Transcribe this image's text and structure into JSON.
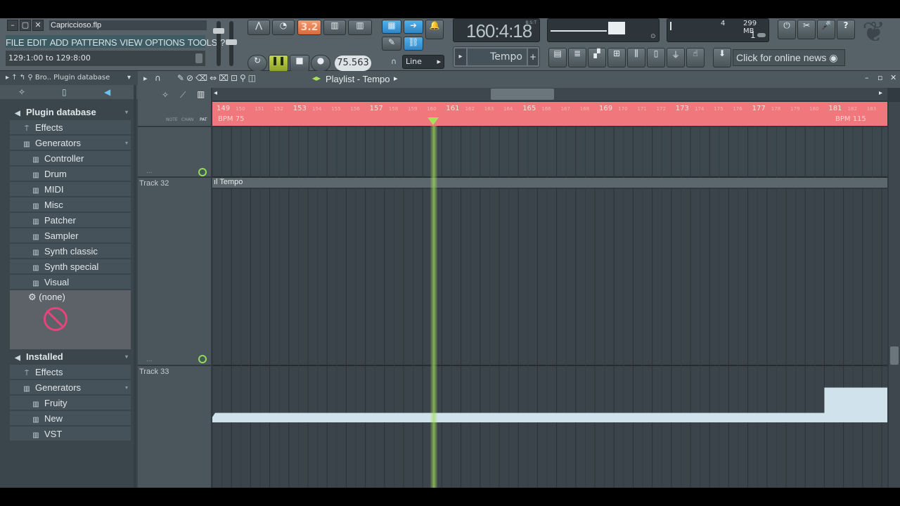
{
  "window": {
    "title": "Capriccioso.flp"
  },
  "menu": [
    "FILE",
    "EDIT",
    "ADD",
    "PATTERNS",
    "VIEW",
    "OPTIONS",
    "TOOLS",
    "?"
  ],
  "hint_bar": "129:1:00 to 129:8:00",
  "transport": {
    "pattern_number": "3.2",
    "tempo": "75.563",
    "song_position": "160:4:18",
    "bst_label": "B:S:T",
    "snap_mode": "Line"
  },
  "monitor": {
    "memory": "299 MB",
    "poly_top": "4",
    "poly_bottom": "1"
  },
  "channel_selector": "Tempo",
  "news": "Click for online news",
  "browser": {
    "path_label": "Bro.. Plugin database",
    "items": [
      {
        "label": "Plugin database",
        "icon": "speaker-icon",
        "level": 0
      },
      {
        "label": "Effects",
        "icon": "effects-icon",
        "level": 1
      },
      {
        "label": "Generators",
        "icon": "piano-icon",
        "level": 1
      },
      {
        "label": "Controller",
        "icon": "piano-icon",
        "level": 2
      },
      {
        "label": "Drum",
        "icon": "piano-icon",
        "level": 2
      },
      {
        "label": "MIDI",
        "icon": "piano-icon",
        "level": 2
      },
      {
        "label": "Misc",
        "icon": "piano-icon",
        "level": 2
      },
      {
        "label": "Patcher",
        "icon": "piano-icon",
        "level": 2
      },
      {
        "label": "Sampler",
        "icon": "piano-icon",
        "level": 2
      },
      {
        "label": "Synth classic",
        "icon": "piano-icon",
        "level": 2
      },
      {
        "label": "Synth special",
        "icon": "piano-icon",
        "level": 2
      },
      {
        "label": "Visual",
        "icon": "piano-icon",
        "level": 2
      }
    ],
    "none_label": "(none)",
    "items2": [
      {
        "label": "Installed",
        "icon": "speaker-icon",
        "level": 0
      },
      {
        "label": "Effects",
        "icon": "effects-icon",
        "level": 1
      },
      {
        "label": "Generators",
        "icon": "piano-icon",
        "level": 1
      },
      {
        "label": "Fruity",
        "icon": "piano-icon",
        "level": 2
      },
      {
        "label": "New",
        "icon": "piano-icon",
        "level": 2
      },
      {
        "label": "VST",
        "icon": "piano-icon",
        "level": 2
      }
    ]
  },
  "playlist": {
    "title": "Playlist - Tempo",
    "header_labels": {
      "note": "NOTE",
      "chan": "CHAN",
      "pat": "PAT"
    },
    "bars": [
      "149",
      "150",
      "151",
      "152",
      "153",
      "154",
      "155",
      "156",
      "157",
      "158",
      "159",
      "160",
      "161",
      "162",
      "163",
      "164",
      "165",
      "166",
      "167",
      "168",
      "169",
      "170",
      "171",
      "172",
      "173",
      "174",
      "175",
      "176",
      "177",
      "178",
      "179",
      "180",
      "181",
      "182",
      "183"
    ],
    "bpm_start": "BPM 75",
    "bpm_end": "BPM 115",
    "tracks": [
      {
        "label": "Track 32"
      },
      {
        "label": "Track 33"
      }
    ],
    "clip_label": "Tempo",
    "automation": {
      "start_value_bpm": 75,
      "end_value_bpm": 115,
      "step_at_bar": 181
    }
  },
  "colors": {
    "ruler": "#f0787c",
    "playhead": "#a6e05a",
    "automation": "#d8ecf6",
    "transport_active": "#ee8050",
    "blue_button": "#3a9ee0"
  }
}
